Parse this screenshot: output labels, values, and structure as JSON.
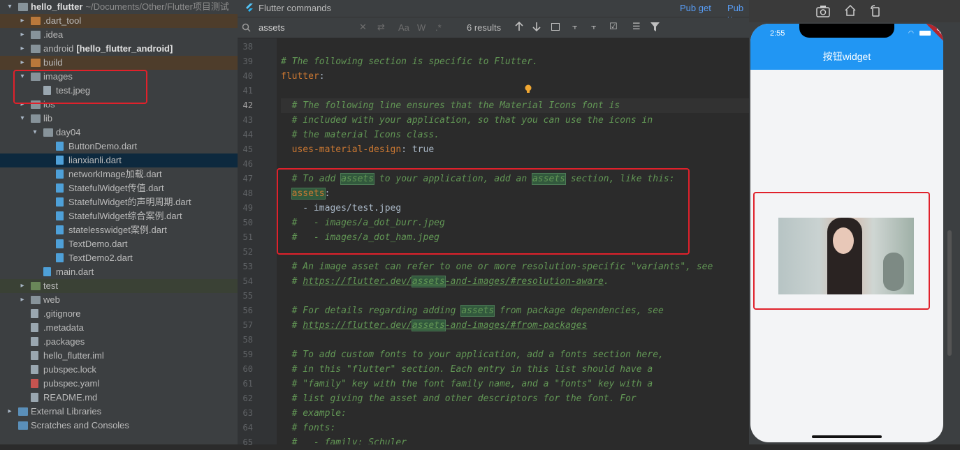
{
  "project_tree": {
    "items": [
      {
        "arrow": "down",
        "icon": "folder",
        "label": "hello_flutter",
        "suffix": "~/Documents/Other/Flutter项目测试",
        "bold": true
      },
      {
        "arrow": "right",
        "icon": "folder-orange",
        "label": ".dart_tool"
      },
      {
        "arrow": "right",
        "icon": "folder",
        "label": ".idea"
      },
      {
        "arrow": "right",
        "icon": "folder",
        "label": "android",
        "suffix": "[hello_flutter_android]",
        "bold_suffix": true
      },
      {
        "arrow": "right",
        "icon": "folder-orange",
        "label": "build"
      },
      {
        "arrow": "down",
        "icon": "folder",
        "label": "images"
      },
      {
        "arrow": "",
        "icon": "file",
        "label": "test.jpeg"
      },
      {
        "arrow": "right",
        "icon": "folder",
        "label": "ios"
      },
      {
        "arrow": "down",
        "icon": "folder",
        "label": "lib"
      },
      {
        "arrow": "down",
        "icon": "folder",
        "label": "day04"
      },
      {
        "arrow": "",
        "icon": "dart",
        "label": "ButtonDemo.dart"
      },
      {
        "arrow": "",
        "icon": "dart",
        "label": "lianxianli.dart"
      },
      {
        "arrow": "",
        "icon": "dart",
        "label": "networkImage加载.dart"
      },
      {
        "arrow": "",
        "icon": "dart",
        "label": "StatefulWidget传值.dart"
      },
      {
        "arrow": "",
        "icon": "dart",
        "label": "StatefulWidget的声明周期.dart"
      },
      {
        "arrow": "",
        "icon": "dart",
        "label": "StatefulWidget综合案例.dart"
      },
      {
        "arrow": "",
        "icon": "dart",
        "label": "statelesswidget案例.dart"
      },
      {
        "arrow": "",
        "icon": "dart",
        "label": "TextDemo.dart"
      },
      {
        "arrow": "",
        "icon": "dart",
        "label": "TextDemo2.dart"
      },
      {
        "arrow": "",
        "icon": "dart",
        "label": "main.dart"
      },
      {
        "arrow": "right",
        "icon": "folder-green",
        "label": "test"
      },
      {
        "arrow": "right",
        "icon": "folder",
        "label": "web"
      },
      {
        "arrow": "",
        "icon": "file",
        "label": ".gitignore"
      },
      {
        "arrow": "",
        "icon": "file",
        "label": ".metadata"
      },
      {
        "arrow": "",
        "icon": "file",
        "label": ".packages"
      },
      {
        "arrow": "",
        "icon": "file",
        "label": "hello_flutter.iml"
      },
      {
        "arrow": "",
        "icon": "file",
        "label": "pubspec.lock"
      },
      {
        "arrow": "",
        "icon": "yml",
        "label": "pubspec.yaml"
      },
      {
        "arrow": "",
        "icon": "file",
        "label": "README.md"
      },
      {
        "arrow": "right",
        "icon": "library",
        "label": "External Libraries"
      },
      {
        "arrow": "",
        "icon": "scratch",
        "label": "Scratches and Consoles"
      }
    ]
  },
  "editor": {
    "tab_title": "Flutter commands",
    "pub_get": "Pub get",
    "pub_upgrade": "Pub u",
    "search_value": "assets",
    "results": "6 results",
    "search_tools": [
      "Aa",
      "W",
      ".*"
    ]
  },
  "code_lines": [
    {
      "n": "38",
      "s": []
    },
    {
      "n": "39",
      "s": [
        {
          "t": "# The following section is specific to Flutter.",
          "c": "cm"
        }
      ]
    },
    {
      "n": "40",
      "s": [
        {
          "t": "flutter",
          "c": "ky"
        },
        {
          "t": ":",
          "c": "pl"
        }
      ]
    },
    {
      "n": "41",
      "s": []
    },
    {
      "n": "42",
      "s": [
        {
          "t": "  # The following line ensures that the Material Icons font is",
          "c": "cm"
        }
      ]
    },
    {
      "n": "43",
      "s": [
        {
          "t": "  # included with your application, so that you can use the icons in",
          "c": "cm"
        }
      ]
    },
    {
      "n": "44",
      "s": [
        {
          "t": "  # the material Icons class.",
          "c": "cm"
        }
      ]
    },
    {
      "n": "45",
      "s": [
        {
          "t": "  uses-material-design",
          "c": "ky"
        },
        {
          "t": ": true",
          "c": "pl"
        }
      ]
    },
    {
      "n": "46",
      "s": []
    },
    {
      "n": "47",
      "s": [
        {
          "t": "  # To add ",
          "c": "cm"
        },
        {
          "t": "assets",
          "c": "cm hl"
        },
        {
          "t": " to your application, add an ",
          "c": "cm"
        },
        {
          "t": "assets",
          "c": "cm hl"
        },
        {
          "t": " section, like this:",
          "c": "cm"
        }
      ]
    },
    {
      "n": "48",
      "s": [
        {
          "t": "  ",
          "c": "pl"
        },
        {
          "t": "assets",
          "c": "ky hl"
        },
        {
          "t": ":",
          "c": "pl"
        }
      ]
    },
    {
      "n": "49",
      "s": [
        {
          "t": "    - images/test.jpeg",
          "c": "pl"
        }
      ]
    },
    {
      "n": "50",
      "s": [
        {
          "t": "  #   - images/a_dot_burr.jpeg",
          "c": "cm"
        }
      ]
    },
    {
      "n": "51",
      "s": [
        {
          "t": "  #   - images/a_dot_ham.jpeg",
          "c": "cm"
        }
      ]
    },
    {
      "n": "52",
      "s": []
    },
    {
      "n": "53",
      "s": [
        {
          "t": "  # An image asset can refer to one or more resolution-specific \"variants\", see",
          "c": "cm"
        }
      ]
    },
    {
      "n": "54",
      "s": [
        {
          "t": "  # ",
          "c": "cm"
        },
        {
          "t": "https://flutter.dev/",
          "c": "cm ul"
        },
        {
          "t": "assets",
          "c": "cm ul hl"
        },
        {
          "t": "-and-images/#resolution-aware",
          "c": "cm ul"
        },
        {
          "t": ".",
          "c": "cm"
        }
      ]
    },
    {
      "n": "55",
      "s": []
    },
    {
      "n": "56",
      "s": [
        {
          "t": "  # For details regarding adding ",
          "c": "cm"
        },
        {
          "t": "assets",
          "c": "cm hl"
        },
        {
          "t": " from package dependencies, see",
          "c": "cm"
        }
      ]
    },
    {
      "n": "57",
      "s": [
        {
          "t": "  # ",
          "c": "cm"
        },
        {
          "t": "https://flutter.dev/",
          "c": "cm ul"
        },
        {
          "t": "assets",
          "c": "cm ul hl"
        },
        {
          "t": "-and-images/#from-packages",
          "c": "cm ul"
        }
      ]
    },
    {
      "n": "58",
      "s": []
    },
    {
      "n": "59",
      "s": [
        {
          "t": "  # To add custom fonts to your application, add a fonts section here,",
          "c": "cm"
        }
      ]
    },
    {
      "n": "60",
      "s": [
        {
          "t": "  # in this \"flutter\" section. Each entry in this list should have a",
          "c": "cm"
        }
      ]
    },
    {
      "n": "61",
      "s": [
        {
          "t": "  # \"family\" key with the font family name, and a \"fonts\" key with a",
          "c": "cm"
        }
      ]
    },
    {
      "n": "62",
      "s": [
        {
          "t": "  # list giving the asset and other descriptors for the font. For",
          "c": "cm"
        }
      ]
    },
    {
      "n": "63",
      "s": [
        {
          "t": "  # example:",
          "c": "cm"
        }
      ]
    },
    {
      "n": "64",
      "s": [
        {
          "t": "  # fonts:",
          "c": "cm"
        }
      ]
    },
    {
      "n": "65",
      "s": [
        {
          "t": "  #   - family: Schuler",
          "c": "cm"
        }
      ]
    }
  ],
  "phone": {
    "time": "2:55",
    "appbar_title": "按钮widget",
    "debug_banner": "DEBUG",
    "accent": "#2196f3"
  },
  "colors": {
    "highlight_box": "#e0212b"
  }
}
